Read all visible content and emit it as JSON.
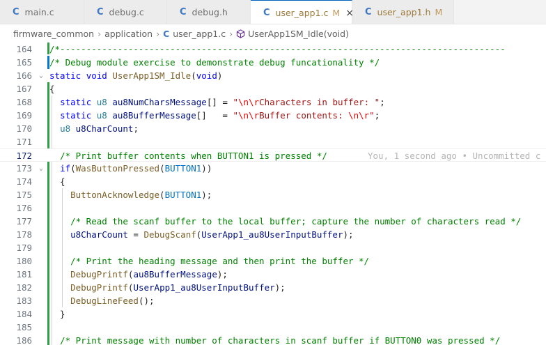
{
  "tabs": [
    {
      "lang": "C",
      "name": "main.c",
      "modified": false,
      "active": false
    },
    {
      "lang": "C",
      "name": "debug.c",
      "modified": false,
      "active": false
    },
    {
      "lang": "C",
      "name": "debug.h",
      "modified": false,
      "active": false
    },
    {
      "lang": "C",
      "name": "user_app1.c",
      "modified": true,
      "mod_label": "M",
      "active": true
    },
    {
      "lang": "C",
      "name": "user_app1.h",
      "modified": true,
      "mod_label": "M",
      "active": false
    }
  ],
  "tab_close_glyph": "×",
  "breadcrumb": {
    "folder1": "firmware_common",
    "folder2": "application",
    "file_lang": "C",
    "file": "user_app1.c",
    "symbol": "UserApp1SM_Idle(void)"
  },
  "blame": "You, 1 second ago • Uncommitted c",
  "lines": [
    {
      "n": "164",
      "text": "/*-------------------------------------------------------------------------------------"
    },
    {
      "n": "165",
      "text": "/* Debug module exercise to demonstrate debug funcationality */"
    },
    {
      "n": "166",
      "text": "static void UserApp1SM_Idle(void)"
    },
    {
      "n": "167",
      "text": "{"
    },
    {
      "n": "168",
      "text": "  static u8 au8NumCharsMessage[] = \"\\n\\rCharacters in buffer: \";"
    },
    {
      "n": "169",
      "text": "  static u8 au8BufferMessage[]   = \"\\n\\rBuffer contents: \\n\\r\";"
    },
    {
      "n": "170",
      "text": "  u8 u8CharCount;"
    },
    {
      "n": "171",
      "text": ""
    },
    {
      "n": "172",
      "text": "  /* Print buffer contents when BUTTON1 is pressed */"
    },
    {
      "n": "173",
      "text": "  if(WasButtonPressed(BUTTON1))"
    },
    {
      "n": "174",
      "text": "  {"
    },
    {
      "n": "175",
      "text": "    ButtonAcknowledge(BUTTON1);"
    },
    {
      "n": "176",
      "text": ""
    },
    {
      "n": "177",
      "text": "    /* Read the scanf buffer to the local buffer; capture the number of characters read */"
    },
    {
      "n": "178",
      "text": "    u8CharCount = DebugScanf(UserApp1_au8UserInputBuffer);"
    },
    {
      "n": "179",
      "text": ""
    },
    {
      "n": "180",
      "text": "    /* Print the heading message and then print the buffer */"
    },
    {
      "n": "181",
      "text": "    DebugPrintf(au8BufferMessage);"
    },
    {
      "n": "182",
      "text": "    DebugPrintf(UserApp1_au8UserInputBuffer);"
    },
    {
      "n": "183",
      "text": "    DebugLineFeed();"
    },
    {
      "n": "184",
      "text": "  }"
    },
    {
      "n": "185",
      "text": ""
    },
    {
      "n": "186",
      "text": "  /* Print message with number of characters in scanf buffer if BUTTON0 was pressed */"
    }
  ],
  "colors": {
    "added_bar": "#2ea043",
    "modified_bar": "#0078d4",
    "accent": "#005fb8"
  }
}
